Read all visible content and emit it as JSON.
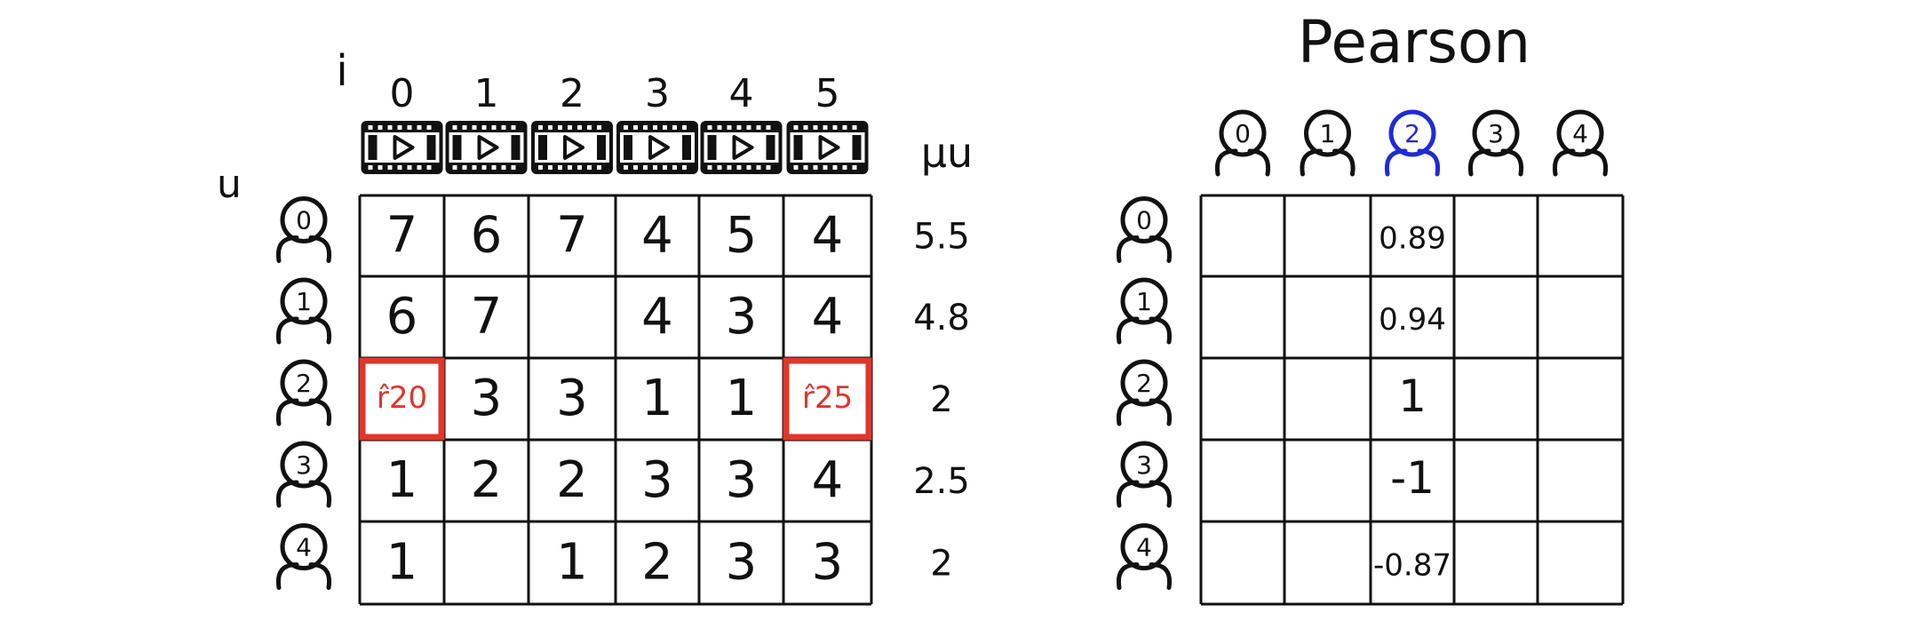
{
  "left": {
    "item_axis_label": "i",
    "user_axis_label": "u",
    "mean_header": "μu",
    "item_ids": [
      "0",
      "1",
      "2",
      "3",
      "4",
      "5"
    ],
    "user_ids": [
      "0",
      "1",
      "2",
      "3",
      "4"
    ],
    "ratings": [
      [
        "7",
        "6",
        "7",
        "4",
        "5",
        "4"
      ],
      [
        "6",
        "7",
        "",
        "4",
        "3",
        "4"
      ],
      [
        "r̂20",
        "3",
        "3",
        "1",
        "1",
        "r̂25"
      ],
      [
        "1",
        "2",
        "2",
        "3",
        "3",
        "4"
      ],
      [
        "1",
        "",
        "1",
        "2",
        "3",
        "3"
      ]
    ],
    "highlight_cells": [
      [
        2,
        0
      ],
      [
        2,
        5
      ]
    ],
    "means": [
      "5.5",
      "4.8",
      "2",
      "2.5",
      "2"
    ],
    "icon": "film-strip-play-icon",
    "user_icon": "user-icon"
  },
  "right": {
    "title": "Pearson",
    "col_user_ids": [
      "0",
      "1",
      "2",
      "3",
      "4"
    ],
    "row_user_ids": [
      "0",
      "1",
      "2",
      "3",
      "4"
    ],
    "highlight_col": 2,
    "column_values": [
      "0.89",
      "0.94",
      "1",
      "-1",
      "-0.87"
    ]
  },
  "colors": {
    "ink": "#111111",
    "highlight_red": "#e0362b",
    "highlight_blue": "#1f2bd6"
  }
}
